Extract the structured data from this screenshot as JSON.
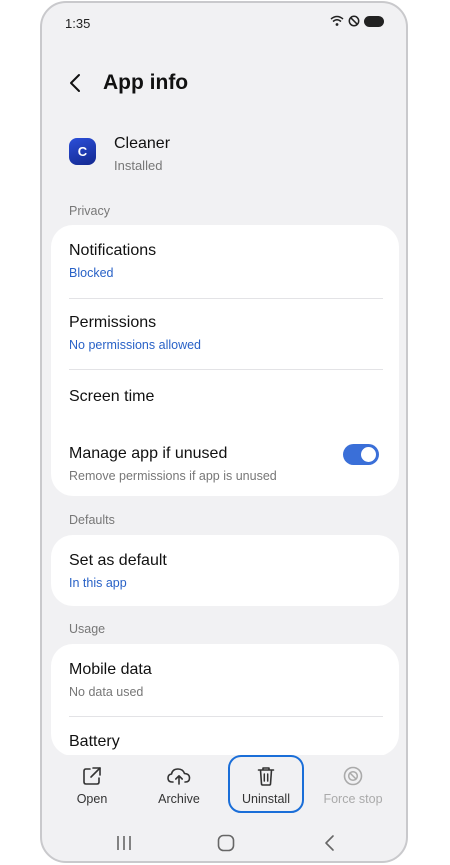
{
  "status_bar": {
    "time": "1:35",
    "icons": [
      "wifi-calling-icon",
      "do-not-disturb-icon",
      "battery-icon"
    ]
  },
  "app_bar": {
    "title": "App info",
    "back_icon": "chevron-left-icon"
  },
  "app": {
    "icon_letter": "C",
    "name": "Cleaner",
    "status": "Installed",
    "icon_color": "#1f3bbf"
  },
  "sections": {
    "privacy": {
      "label": "Privacy",
      "items": [
        {
          "title": "Notifications",
          "subtitle": "Blocked"
        },
        {
          "title": "Permissions",
          "subtitle": "No permissions allowed"
        },
        {
          "title": "Screen time"
        },
        {
          "title": "Manage app if unused",
          "subtitle": "Remove permissions if app is unused",
          "toggle_on": true
        }
      ]
    },
    "defaults": {
      "label": "Defaults",
      "items": [
        {
          "title": "Set as default",
          "subtitle": "In this app"
        }
      ]
    },
    "usage": {
      "label": "Usage",
      "items": [
        {
          "title": "Mobile data",
          "subtitle": "No data used"
        },
        {
          "title": "Battery"
        }
      ]
    }
  },
  "actions": [
    {
      "label": "Open",
      "icon": "open-external-icon",
      "enabled": true
    },
    {
      "label": "Archive",
      "icon": "cloud-upload-icon",
      "enabled": true
    },
    {
      "label": "Uninstall",
      "icon": "trash-icon",
      "enabled": true,
      "highlighted": true
    },
    {
      "label": "Force stop",
      "icon": "block-icon",
      "enabled": false
    }
  ],
  "nav_bar": {
    "buttons": [
      "recents-icon",
      "home-icon",
      "back-icon"
    ]
  },
  "colors": {
    "accent": "#2962c7",
    "toggle": "#3a6fd8",
    "highlight": "#1a6ed8",
    "background": "#f1f1f3"
  }
}
